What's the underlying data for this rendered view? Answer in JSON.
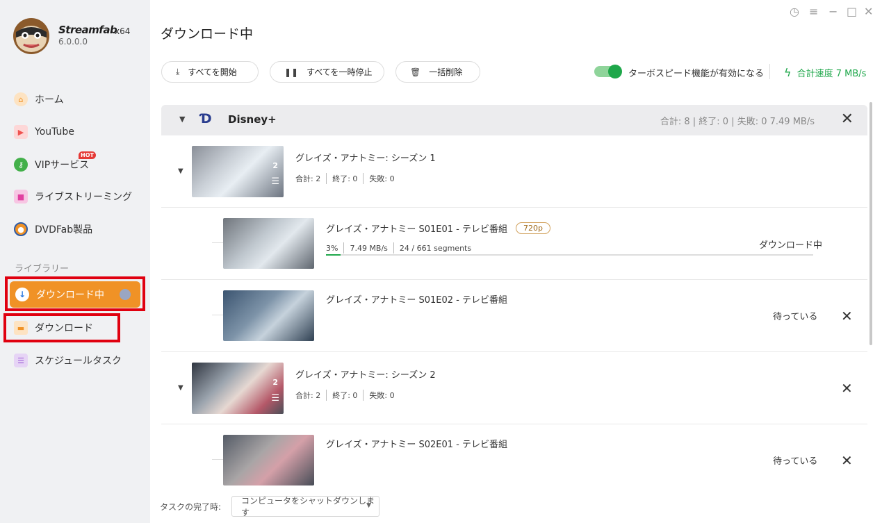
{
  "app": {
    "brand": "Streamfab",
    "arch": "x64",
    "version": "6.0.0.0"
  },
  "sidebar": {
    "items": [
      {
        "label": "ホーム",
        "icon": "home-icon",
        "color": "#f09226"
      },
      {
        "label": "YouTube",
        "icon": "youtube-icon",
        "color": "#ef5350"
      },
      {
        "label": "VIPサービス",
        "icon": "key-icon",
        "color": "#43b04a",
        "badge": "HOT"
      },
      {
        "label": "ライブストリーミング",
        "icon": "live-camera-icon",
        "color": "#e040a0"
      },
      {
        "label": "DVDFab製品",
        "icon": "dvdfab-icon",
        "color": "#f09226"
      }
    ],
    "library_label": "ライブラリー",
    "library": [
      {
        "label": "ダウンロード中",
        "icon": "download-arrow-icon"
      },
      {
        "label": "ダウンロード",
        "icon": "folder-icon"
      },
      {
        "label": "スケジュールタスク",
        "icon": "schedule-icon"
      }
    ]
  },
  "header": {
    "title": "ダウンロード中"
  },
  "toolbar": {
    "start_all": "すべてを開始",
    "pause_all": "すべてを一時停止",
    "delete_all": "一括削除",
    "turbo_label": "ターボスピード機能が有効になる",
    "turbo_enabled": true,
    "total_speed": "合計速度 7 MB/s"
  },
  "group": {
    "name": "Disney+",
    "stats": "合計: 8 | 終了: 0 | 失敗: 0   7.49 MB/s"
  },
  "seasons": [
    {
      "title": "グレイズ・アナトミー: シーズン 1",
      "count": "2",
      "total": "合計: 2",
      "done": "終了: 0",
      "failed": "失敗: 0",
      "episodes": [
        {
          "title": "グレイズ・アナトミー S01E01 - テレビ番組",
          "quality": "720p",
          "percent": "3%",
          "progress": 0.03,
          "speed": "7.49 MB/s",
          "segments": "24 / 661 segments",
          "status": "ダウンロード中"
        },
        {
          "title": "グレイズ・アナトミー S01E02 - テレビ番組",
          "status": "待っている"
        }
      ]
    },
    {
      "title": "グレイズ・アナトミー: シーズン 2",
      "count": "2",
      "total": "合計: 2",
      "done": "終了: 0",
      "failed": "失敗: 0",
      "episodes": [
        {
          "title": "グレイズ・アナトミー S02E01 - テレビ番組",
          "status": "待っている"
        }
      ]
    }
  ],
  "footer": {
    "label": "タスクの完了時:",
    "select_value": "コンピュータをシャットダウンします"
  }
}
